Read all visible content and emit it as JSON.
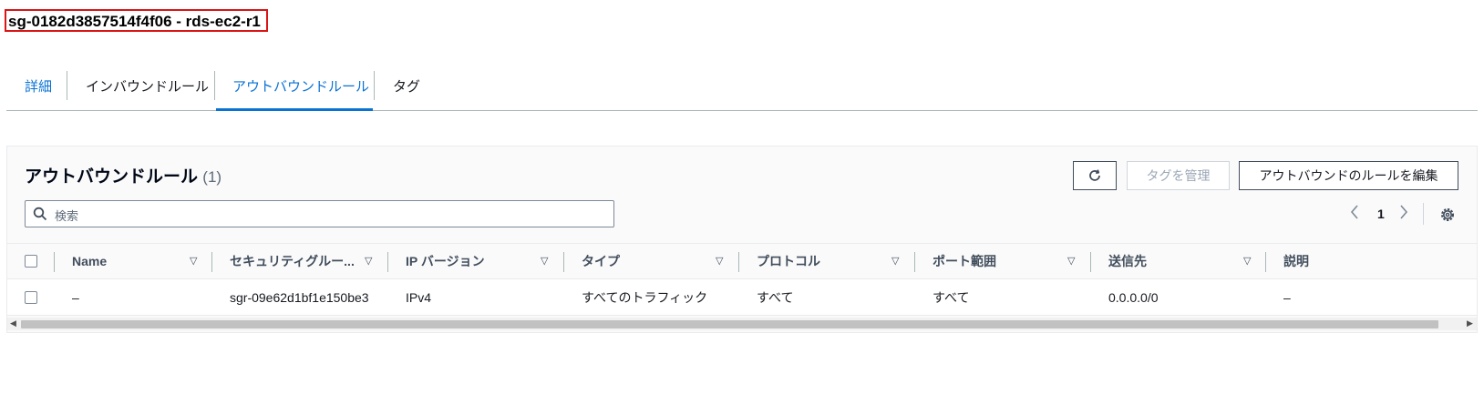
{
  "header": {
    "title": "sg-0182d3857514f4f06 - rds-ec2-r1"
  },
  "tabs": [
    {
      "label": "詳細"
    },
    {
      "label": "インバウンドルール"
    },
    {
      "label": "アウトバウンドルール"
    },
    {
      "label": "タグ"
    }
  ],
  "panel": {
    "title": "アウトバウンドルール",
    "count": "(1)",
    "buttons": {
      "manage_tags": "タグを管理",
      "edit_rules": "アウトバウンドのルールを編集"
    },
    "search": {
      "placeholder": "検索"
    },
    "pagination": {
      "prev": "‹",
      "page": "1",
      "next": "›"
    },
    "columns": [
      "Name",
      "セキュリティグルー...",
      "IP バージョン",
      "タイプ",
      "プロトコル",
      "ポート範囲",
      "送信先",
      "説明"
    ],
    "rows": [
      {
        "name": "–",
        "rule_id": "sgr-09e62d1bf1e150be3",
        "ip_version": "IPv4",
        "type": "すべてのトラフィック",
        "protocol": "すべて",
        "port_range": "すべて",
        "destination": "0.0.0.0/0",
        "description": "–"
      }
    ]
  },
  "colors": {
    "accent": "#0972d3",
    "highlight_border": "#d91515",
    "text": "#16191f"
  }
}
